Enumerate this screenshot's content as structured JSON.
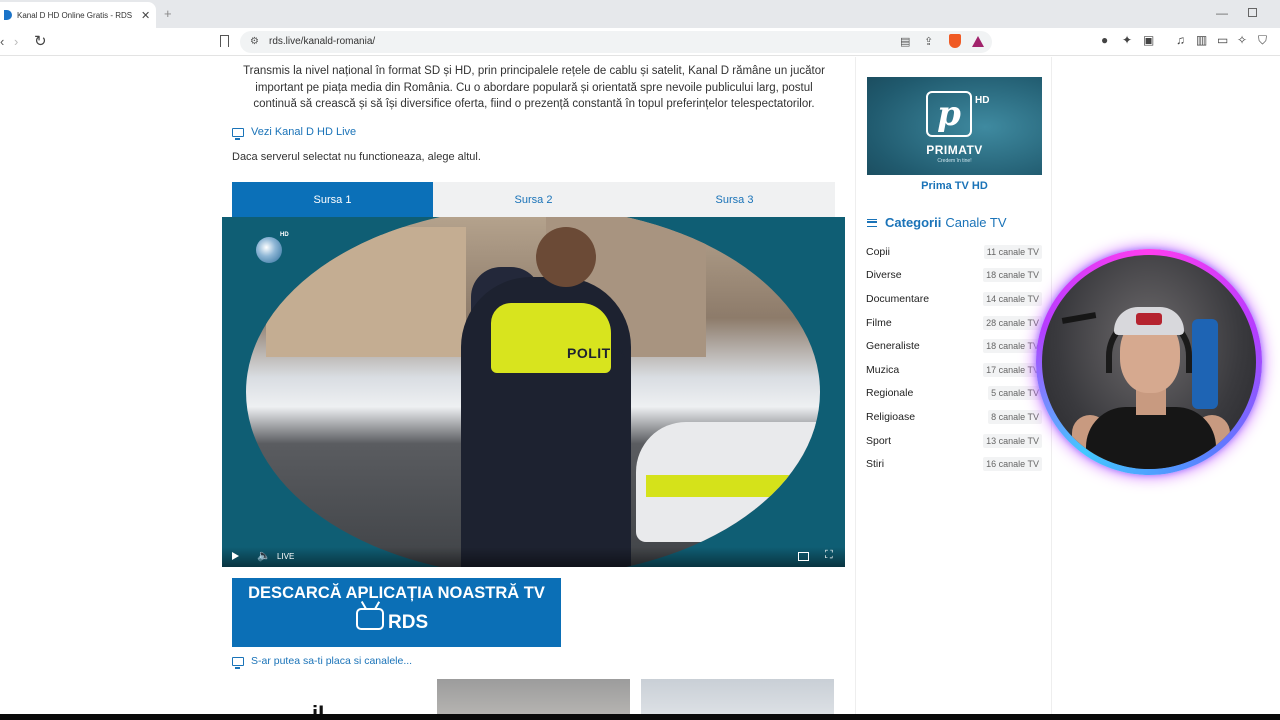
{
  "browser": {
    "tab_title": "Kanal D HD Online Gratis - RDS L",
    "url": "rds.live/kanald-romania/"
  },
  "article": {
    "intro": "Transmis la nivel național în format SD și HD, prin principalele rețele de cablu și satelit, Kanal D rămâne un jucător important pe piața media din România. Cu o abordare populară și orientată spre nevoile publicului larg, postul continuă să crească și să își diversifice oferta, fiind o prezență constantă în topul preferințelor telespectatorilor.",
    "live_link": "Vezi Kanal D HD Live",
    "server_note": "Daca serverul selectat nu functioneaza, alege altul."
  },
  "sources": [
    {
      "label": "Sursa 1",
      "active": true
    },
    {
      "label": "Sursa 2",
      "active": false
    },
    {
      "label": "Sursa 3",
      "active": false
    }
  ],
  "player": {
    "channel_badge": "HD",
    "vest_text": "POLITIA",
    "live_label": "LIVE"
  },
  "app_banner": {
    "headline": "DESCARCĂ APLICAȚIA NOASTRĂ TV",
    "logo_text": "RDS"
  },
  "related": {
    "link": "S-ar putea sa-ti placa si canalele...",
    "thumb1_text": "iL"
  },
  "sidebar": {
    "featured": {
      "logo_hd": "HD",
      "logo_word": "PRIMATV",
      "logo_tagline": "Credem în tine!",
      "caption": "Prima TV HD"
    },
    "categories_heading_bold": "Categorii",
    "categories_heading_rest": "Canale TV",
    "categories": [
      {
        "name": "Copii",
        "count": "11 canale TV"
      },
      {
        "name": "Diverse",
        "count": "18 canale TV"
      },
      {
        "name": "Documentare",
        "count": "14 canale TV"
      },
      {
        "name": "Filme",
        "count": "28 canale TV"
      },
      {
        "name": "Generaliste",
        "count": "18 canale TV"
      },
      {
        "name": "Muzica",
        "count": "17 canale TV"
      },
      {
        "name": "Regionale",
        "count": "5 canale TV"
      },
      {
        "name": "Religioase",
        "count": "8 canale TV"
      },
      {
        "name": "Sport",
        "count": "13 canale TV"
      },
      {
        "name": "Stiri",
        "count": "16 canale TV"
      }
    ]
  },
  "colors": {
    "accent": "#0b70b8",
    "link": "#1a73b8"
  }
}
